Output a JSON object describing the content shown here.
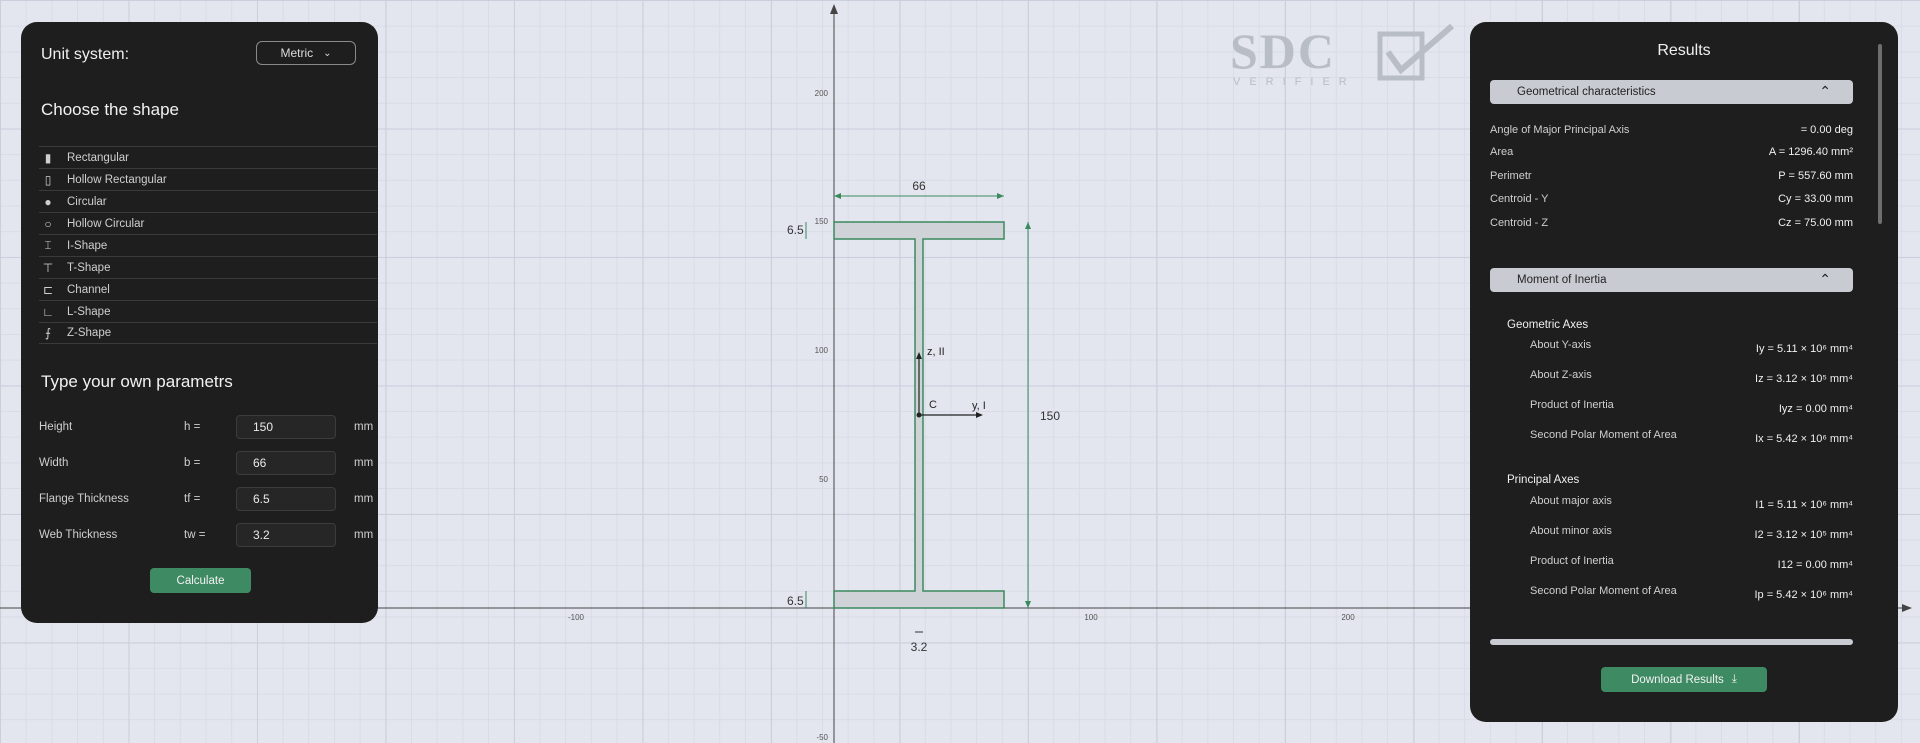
{
  "left_panel": {
    "unit_label": "Unit system:",
    "unit_value": "Metric",
    "choose_title": "Choose the shape",
    "shapes": [
      {
        "icon": "▮",
        "label": "Rectangular"
      },
      {
        "icon": "▯",
        "label": "Hollow Rectangular"
      },
      {
        "icon": "●",
        "label": "Circular"
      },
      {
        "icon": "○",
        "label": "Hollow Circular"
      },
      {
        "icon": "⌶",
        "label": "I-Shape"
      },
      {
        "icon": "⊤",
        "label": "T-Shape"
      },
      {
        "icon": "⊏",
        "label": "Channel"
      },
      {
        "icon": "∟",
        "label": "L-Shape"
      },
      {
        "icon": "⨍",
        "label": "Z-Shape"
      }
    ],
    "params_title": "Type your own parametrs",
    "params": [
      {
        "label": "Height",
        "symbol": "h =",
        "value": "150",
        "unit": "mm"
      },
      {
        "label": "Width",
        "symbol": "b =",
        "value": "66",
        "unit": "mm"
      },
      {
        "label": "Flange Thickness",
        "symbol": "tf =",
        "value": "6.5",
        "unit": "mm"
      },
      {
        "label": "Web Thickness",
        "symbol": "tw =",
        "value": "3.2",
        "unit": "mm"
      }
    ],
    "calculate_label": "Calculate"
  },
  "canvas": {
    "y_ticks": [
      "200",
      "150",
      "100",
      "50",
      "-50"
    ],
    "x_ticks": [
      "-100",
      "100",
      "200"
    ],
    "dim_width": "66",
    "dim_height": "150",
    "dim_flange_top": "6.5",
    "dim_flange_bottom": "6.5",
    "dim_web": "3.2",
    "axis_z_label": "z, II",
    "axis_y_label": "y, I",
    "centroid_label": "C",
    "section": {
      "height": 150,
      "width": 66,
      "flange_thickness": 6.5,
      "web_thickness": 3.2
    }
  },
  "logo": {
    "main": "SDC",
    "sub": "VERIFIER"
  },
  "results": {
    "title": "Results",
    "geo_header": "Geometrical characteristics",
    "geo_rows": [
      {
        "label": "Angle of Major Principal Axis",
        "value": "= 0.00 deg"
      },
      {
        "label": "Area",
        "value": "A = 1296.40 mm²"
      },
      {
        "label": "Perimetr",
        "value": "P = 557.60 mm"
      },
      {
        "label": "Centroid - Y",
        "value": "Cy = 33.00 mm"
      },
      {
        "label": "Centroid - Z",
        "value": "Cz = 75.00 mm"
      }
    ],
    "moi_header": "Moment of Inertia",
    "geometric_axes_title": "Geometric Axes",
    "geometric_rows": [
      {
        "label": "About Y-axis",
        "value": "Iy = 5.11 × 10⁶ mm⁴"
      },
      {
        "label": "About Z-axis",
        "value": "Iz = 3.12 × 10⁵ mm⁴"
      },
      {
        "label": "Product of Inertia",
        "value": "Iyz = 0.00 mm⁴"
      },
      {
        "label": "Second Polar Moment of Area",
        "value": "Ix = 5.42 × 10⁶ mm⁴"
      }
    ],
    "principal_axes_title": "Principal Axes",
    "principal_rows": [
      {
        "label": "About major axis",
        "value": "I1 = 5.11 × 10⁶ mm⁴"
      },
      {
        "label": "About minor axis",
        "value": "I2 = 3.12 × 10⁵ mm⁴"
      },
      {
        "label": "Product of Inertia",
        "value": "I12 = 0.00 mm⁴"
      },
      {
        "label": "Second Polar Moment of Area",
        "value": "Ip = 5.42 × 10⁶ mm⁴"
      }
    ],
    "download_label": "Download Results",
    "download_icon": "download-icon"
  },
  "colors": {
    "accent_green": "#3d8a63",
    "section_fill": "#cfd2d6",
    "section_stroke": "#3b8a5e",
    "panel_bg": "#1e1e1e"
  }
}
